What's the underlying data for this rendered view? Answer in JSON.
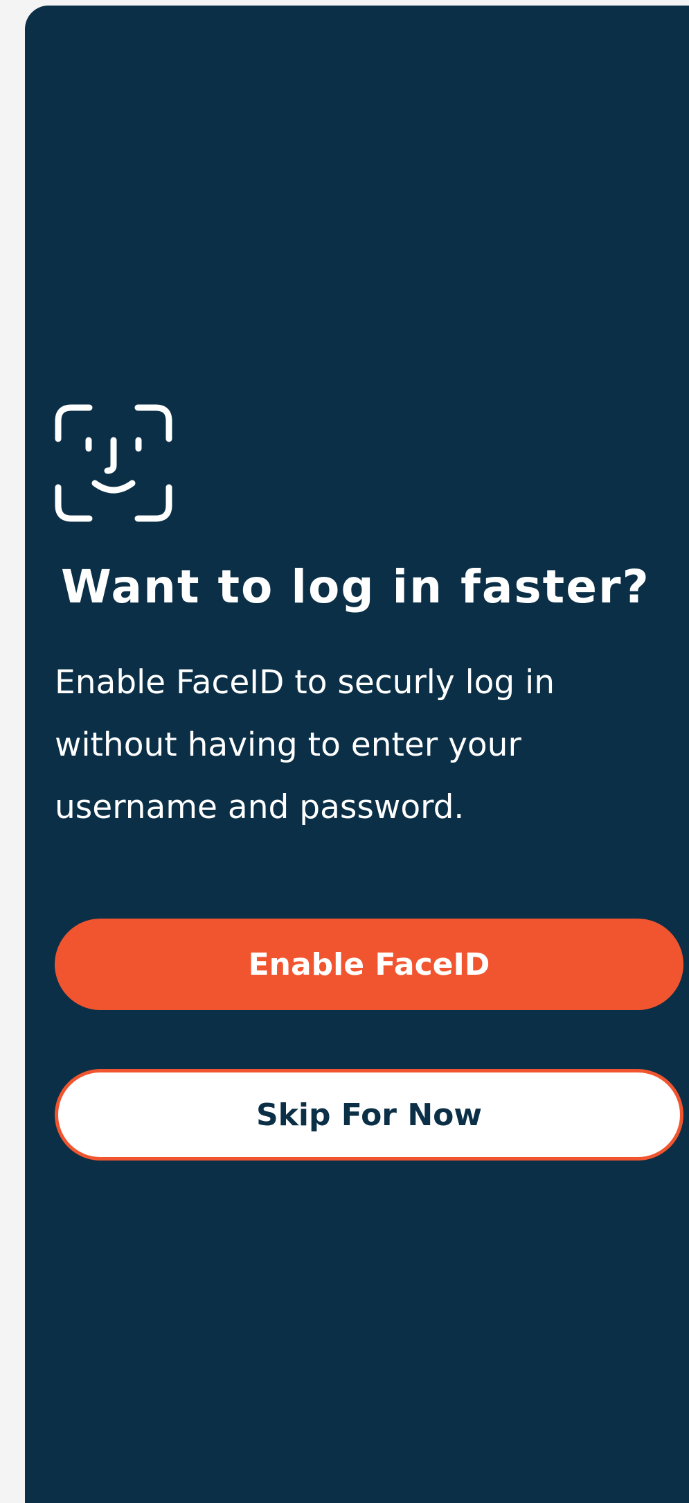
{
  "screen": {
    "title": "Want to log in faster?",
    "description": "Enable FaceID to securly log in without having to enter your username and password.",
    "icon": "faceid-icon"
  },
  "actions": {
    "enable_label": "Enable FaceID",
    "skip_label": "Skip For Now"
  },
  "colors": {
    "background": "#0b2f46",
    "accent": "#f1552f",
    "text": "#ffffff",
    "secondary_button_bg": "#ffffff",
    "page_bg": "#f4f4f4"
  }
}
